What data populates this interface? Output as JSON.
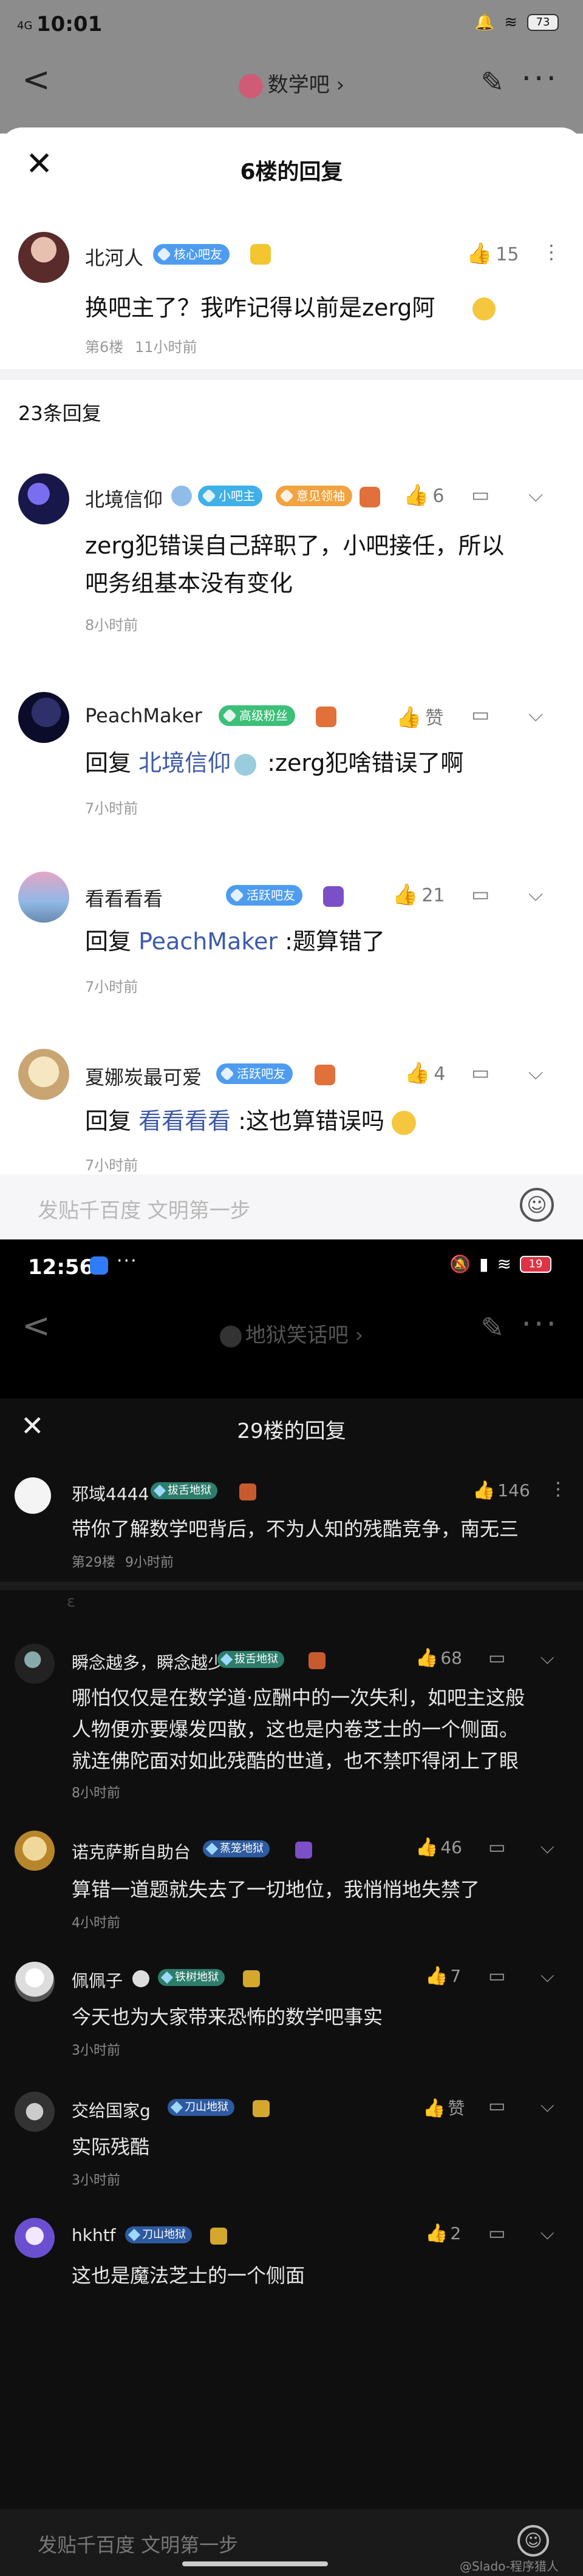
{
  "screen1": {
    "status": {
      "time": "10:01",
      "signal": "4G",
      "battery": "73"
    },
    "nav": {
      "back": "<",
      "title": "数学吧",
      "more": "···"
    },
    "sheet": {
      "title": "6楼的回复",
      "main_post": {
        "user": "北河人",
        "badge": "核心吧友",
        "likes": "15",
        "content": "换吧主了？我咋记得以前是zerg阿",
        "floor": "第6楼",
        "time": "11小时前"
      },
      "reply_count": "23条回复",
      "replies": [
        {
          "user": "北境信仰",
          "badge": "小吧主",
          "badge2": "意见领袖",
          "likes": "6",
          "content_line1": "zerg犯错误自己辞职了，小吧接任，所以",
          "content_line2": "吧务组基本没有变化",
          "time": "8小时前"
        },
        {
          "user": "PeachMaker",
          "badge_level": "9",
          "badge": "高级粉丝",
          "likes": "赞",
          "reply_prefix": "回复",
          "reply_to": "北境信仰",
          "content": " :zerg犯啥错误了啊",
          "time": "7小时前"
        },
        {
          "user": "看看看看",
          "badge_level": "5",
          "badge": "活跃吧友",
          "likes": "21",
          "reply_prefix": "回复",
          "reply_to": "PeachMaker",
          "content": " :题算错了",
          "time": "7小时前"
        },
        {
          "user": "夏娜炭最可爱",
          "badge_level": "5",
          "badge": "活跃吧友",
          "likes": "4",
          "reply_prefix": "回复",
          "reply_to": "看看看看",
          "content": " :这也算错误吗",
          "time": "7小时前"
        }
      ],
      "input_placeholder": "发贴千百度 文明第一步"
    }
  },
  "screen2": {
    "status": {
      "time": "12:56",
      "battery": "19"
    },
    "nav": {
      "back": "<",
      "title": "地狱笑话吧",
      "more": "···"
    },
    "sheet": {
      "title": "29楼的回复",
      "main_post": {
        "user": "邪域4444",
        "badge": "拔舌地狱",
        "likes": "146",
        "content": "带你了解数学吧背后，不为人知的残酷竞争，南无三",
        "floor": "第29楼",
        "time": "9小时前"
      },
      "replies": [
        {
          "user": "瞬念越多，瞬念越少",
          "badge": "拔舌地狱",
          "likes": "68",
          "content_line1": "哪怕仅仅是在数学道·应酬中的一次失利，如吧主这般",
          "content_line2": "人物便亦要爆发四散，这也是内卷芝士的一个侧面。",
          "content_line3": "就连佛陀面对如此残酷的世道，也不禁吓得闭上了眼",
          "time": "8小时前"
        },
        {
          "user": "诺克萨斯自助台",
          "badge": "蒸笼地狱",
          "likes": "46",
          "content_line1": "算错一道题就失去了一切地位，我悄悄地失禁了",
          "time": "4小时前"
        },
        {
          "user": "佩佩子",
          "badge": "铁树地狱",
          "likes": "7",
          "content_line1": "今天也为大家带来恐怖的数学吧事实",
          "time": "3小时前"
        },
        {
          "user": "交给国家g",
          "badge": "刀山地狱",
          "likes": "赞",
          "content_line1": "实际残酷",
          "time": "3小时前"
        },
        {
          "user": "hkhtf",
          "badge": "刀山地狱",
          "likes": "2",
          "content_line1": "这也是魔法芝士的一个侧面",
          "time": ""
        }
      ],
      "input_placeholder": "发贴千百度 文明第一步"
    },
    "watermark": "@Slado-程序猎人"
  }
}
